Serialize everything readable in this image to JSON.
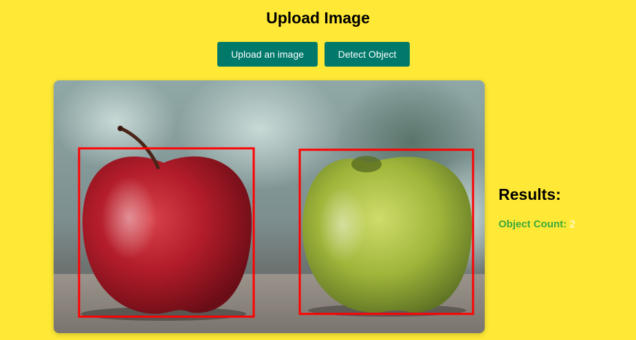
{
  "header": {
    "title": "Upload Image"
  },
  "toolbar": {
    "upload_label": "Upload an image",
    "detect_label": "Detect Object"
  },
  "results": {
    "title": "Results:",
    "count_label": "Object Count:",
    "count_value": "2"
  },
  "colors": {
    "background": "#ffe936",
    "button": "#00796b",
    "bounding_box": "#ff0000",
    "count_label": "#3aa83a"
  }
}
